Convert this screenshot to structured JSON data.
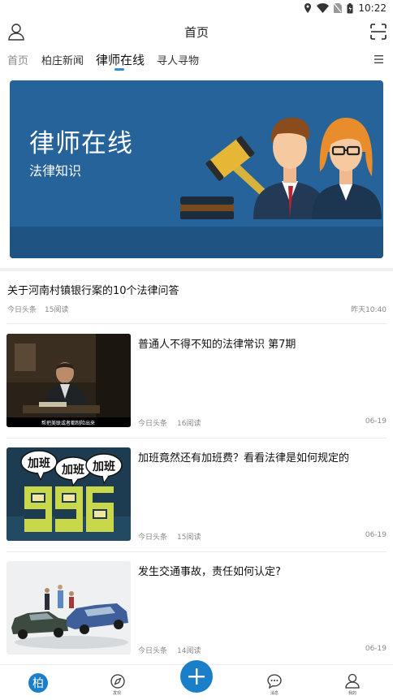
{
  "status_bar": {
    "time": "10:22"
  },
  "header": {
    "title": "首页"
  },
  "tabs": [
    {
      "label": "首页"
    },
    {
      "label": "柏庄新闻"
    },
    {
      "label": "律师在线"
    },
    {
      "label": "寻人寻物"
    }
  ],
  "banner": {
    "title": "律师在线",
    "subtitle": "法律知识"
  },
  "articles": [
    {
      "title": "关于河南村镇银行案的10个法律问答",
      "source": "今日头条",
      "reads": "15阅读",
      "date": "昨天10:40"
    },
    {
      "title": "普通人不得不知的法律常识 第7期",
      "source": "今日头条",
      "reads": "16阅读",
      "date": "06-19",
      "thumb_caption": "帮把美联或者都制险出来"
    },
    {
      "title": "加班竟然还有加班费？看看法律是如何规定的",
      "source": "今日头条",
      "reads": "15阅读",
      "date": "06-19",
      "thumb_bubbles": [
        "加班",
        "加班",
        "加班"
      ]
    },
    {
      "title": "发生交通事故，责任如何认定?",
      "source": "今日头条",
      "reads": "14阅读",
      "date": "06-19"
    }
  ],
  "bottom_nav": [
    {
      "label": "柏",
      "icon": "app-logo-icon"
    },
    {
      "label": "发现",
      "icon": "compass-icon"
    },
    {
      "label": "",
      "icon": "plus-icon"
    },
    {
      "label": "消息",
      "icon": "chat-icon"
    },
    {
      "label": "我的",
      "icon": "person-icon"
    }
  ],
  "colors": {
    "accent": "#1a7ec8",
    "banner_bg": "#25639a"
  }
}
